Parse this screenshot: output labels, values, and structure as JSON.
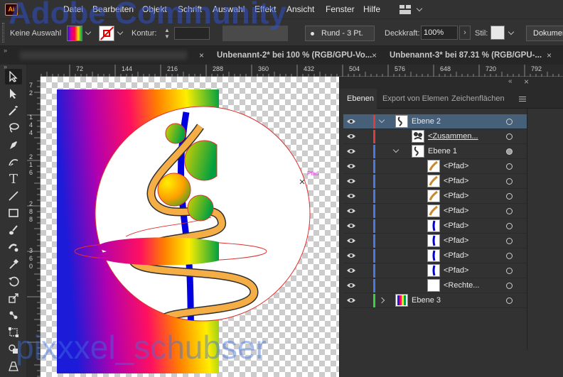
{
  "app": {
    "logo": "Ai"
  },
  "menu": [
    "Datei",
    "Bearbeiten",
    "Objekt",
    "Schrift",
    "Auswahl",
    "Effekt",
    "Ansicht",
    "Fenster",
    "Hilfe"
  ],
  "control": {
    "selection": "Keine Auswahl",
    "kontur_label": "Kontur:",
    "brush": "Rund - 3 Pt.",
    "opacity_label": "Deckkraft:",
    "opacity_value": "100%",
    "stil_label": "Stil:",
    "document_button": "Dokumen"
  },
  "tabs": [
    {
      "label": "Unbenannt-2* bei 100 % (RGB/GPU-Vo..."
    },
    {
      "label": "Unbenannt-3* bei 87.31 % (RGB/GPU-..."
    }
  ],
  "ruler_top": [
    "72",
    "144",
    "216",
    "288",
    "360",
    "432",
    "504",
    "576",
    "648",
    "720",
    "792"
  ],
  "ruler_left": [
    {
      "digits": [
        "7",
        "2"
      ]
    },
    {
      "digits": [
        "1",
        "4",
        "4"
      ]
    },
    {
      "digits": [
        "2",
        "1",
        "6"
      ]
    },
    {
      "digits": [
        "2",
        "8",
        "8"
      ]
    },
    {
      "digits": [
        "3",
        "6",
        "0"
      ]
    }
  ],
  "canvas": {
    "path_hint": "Pfad"
  },
  "panel": {
    "tabs": [
      "Ebenen",
      "Export von Elemen",
      "Zeichenflächen"
    ],
    "rows": [
      {
        "name": "Ebene 2",
        "color": "#e03c3c",
        "expanded": true,
        "selected": true
      },
      {
        "name": "<Zusammen...",
        "color": "#e03c3c",
        "underline": true
      },
      {
        "name": "Ebene 1",
        "color": "#4a78e0",
        "expanded": true
      },
      {
        "name": "<Pfad>",
        "color": "#4a78e0"
      },
      {
        "name": "<Pfad>",
        "color": "#4a78e0"
      },
      {
        "name": "<Pfad>",
        "color": "#4a78e0"
      },
      {
        "name": "<Pfad>",
        "color": "#4a78e0"
      },
      {
        "name": "<Pfad>",
        "color": "#4a78e0"
      },
      {
        "name": "<Pfad>",
        "color": "#4a78e0"
      },
      {
        "name": "<Pfad>",
        "color": "#4a78e0"
      },
      {
        "name": "<Pfad>",
        "color": "#4a78e0"
      },
      {
        "name": "<Rechte...",
        "color": "#4a78e0"
      },
      {
        "name": "Ebene 3",
        "color": "#3cd23c",
        "expanded": false
      }
    ]
  },
  "watermarks": {
    "top": "Adobe Community",
    "bottom": "pixxxel_schubser"
  }
}
